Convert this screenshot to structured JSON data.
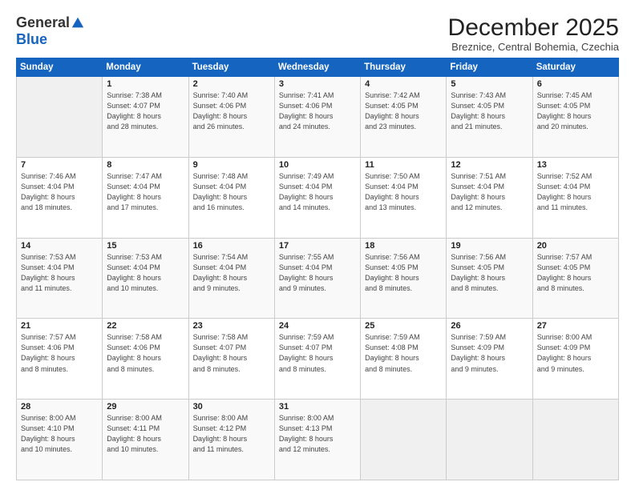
{
  "logo": {
    "general": "General",
    "blue": "Blue"
  },
  "title": "December 2025",
  "subtitle": "Breznice, Central Bohemia, Czechia",
  "weekdays": [
    "Sunday",
    "Monday",
    "Tuesday",
    "Wednesday",
    "Thursday",
    "Friday",
    "Saturday"
  ],
  "weeks": [
    [
      {
        "date": "",
        "info": ""
      },
      {
        "date": "1",
        "info": "Sunrise: 7:38 AM\nSunset: 4:07 PM\nDaylight: 8 hours\nand 28 minutes."
      },
      {
        "date": "2",
        "info": "Sunrise: 7:40 AM\nSunset: 4:06 PM\nDaylight: 8 hours\nand 26 minutes."
      },
      {
        "date": "3",
        "info": "Sunrise: 7:41 AM\nSunset: 4:06 PM\nDaylight: 8 hours\nand 24 minutes."
      },
      {
        "date": "4",
        "info": "Sunrise: 7:42 AM\nSunset: 4:05 PM\nDaylight: 8 hours\nand 23 minutes."
      },
      {
        "date": "5",
        "info": "Sunrise: 7:43 AM\nSunset: 4:05 PM\nDaylight: 8 hours\nand 21 minutes."
      },
      {
        "date": "6",
        "info": "Sunrise: 7:45 AM\nSunset: 4:05 PM\nDaylight: 8 hours\nand 20 minutes."
      }
    ],
    [
      {
        "date": "7",
        "info": "Sunrise: 7:46 AM\nSunset: 4:04 PM\nDaylight: 8 hours\nand 18 minutes."
      },
      {
        "date": "8",
        "info": "Sunrise: 7:47 AM\nSunset: 4:04 PM\nDaylight: 8 hours\nand 17 minutes."
      },
      {
        "date": "9",
        "info": "Sunrise: 7:48 AM\nSunset: 4:04 PM\nDaylight: 8 hours\nand 16 minutes."
      },
      {
        "date": "10",
        "info": "Sunrise: 7:49 AM\nSunset: 4:04 PM\nDaylight: 8 hours\nand 14 minutes."
      },
      {
        "date": "11",
        "info": "Sunrise: 7:50 AM\nSunset: 4:04 PM\nDaylight: 8 hours\nand 13 minutes."
      },
      {
        "date": "12",
        "info": "Sunrise: 7:51 AM\nSunset: 4:04 PM\nDaylight: 8 hours\nand 12 minutes."
      },
      {
        "date": "13",
        "info": "Sunrise: 7:52 AM\nSunset: 4:04 PM\nDaylight: 8 hours\nand 11 minutes."
      }
    ],
    [
      {
        "date": "14",
        "info": "Sunrise: 7:53 AM\nSunset: 4:04 PM\nDaylight: 8 hours\nand 11 minutes."
      },
      {
        "date": "15",
        "info": "Sunrise: 7:53 AM\nSunset: 4:04 PM\nDaylight: 8 hours\nand 10 minutes."
      },
      {
        "date": "16",
        "info": "Sunrise: 7:54 AM\nSunset: 4:04 PM\nDaylight: 8 hours\nand 9 minutes."
      },
      {
        "date": "17",
        "info": "Sunrise: 7:55 AM\nSunset: 4:04 PM\nDaylight: 8 hours\nand 9 minutes."
      },
      {
        "date": "18",
        "info": "Sunrise: 7:56 AM\nSunset: 4:05 PM\nDaylight: 8 hours\nand 8 minutes."
      },
      {
        "date": "19",
        "info": "Sunrise: 7:56 AM\nSunset: 4:05 PM\nDaylight: 8 hours\nand 8 minutes."
      },
      {
        "date": "20",
        "info": "Sunrise: 7:57 AM\nSunset: 4:05 PM\nDaylight: 8 hours\nand 8 minutes."
      }
    ],
    [
      {
        "date": "21",
        "info": "Sunrise: 7:57 AM\nSunset: 4:06 PM\nDaylight: 8 hours\nand 8 minutes."
      },
      {
        "date": "22",
        "info": "Sunrise: 7:58 AM\nSunset: 4:06 PM\nDaylight: 8 hours\nand 8 minutes."
      },
      {
        "date": "23",
        "info": "Sunrise: 7:58 AM\nSunset: 4:07 PM\nDaylight: 8 hours\nand 8 minutes."
      },
      {
        "date": "24",
        "info": "Sunrise: 7:59 AM\nSunset: 4:07 PM\nDaylight: 8 hours\nand 8 minutes."
      },
      {
        "date": "25",
        "info": "Sunrise: 7:59 AM\nSunset: 4:08 PM\nDaylight: 8 hours\nand 8 minutes."
      },
      {
        "date": "26",
        "info": "Sunrise: 7:59 AM\nSunset: 4:09 PM\nDaylight: 8 hours\nand 9 minutes."
      },
      {
        "date": "27",
        "info": "Sunrise: 8:00 AM\nSunset: 4:09 PM\nDaylight: 8 hours\nand 9 minutes."
      }
    ],
    [
      {
        "date": "28",
        "info": "Sunrise: 8:00 AM\nSunset: 4:10 PM\nDaylight: 8 hours\nand 10 minutes."
      },
      {
        "date": "29",
        "info": "Sunrise: 8:00 AM\nSunset: 4:11 PM\nDaylight: 8 hours\nand 10 minutes."
      },
      {
        "date": "30",
        "info": "Sunrise: 8:00 AM\nSunset: 4:12 PM\nDaylight: 8 hours\nand 11 minutes."
      },
      {
        "date": "31",
        "info": "Sunrise: 8:00 AM\nSunset: 4:13 PM\nDaylight: 8 hours\nand 12 minutes."
      },
      {
        "date": "",
        "info": ""
      },
      {
        "date": "",
        "info": ""
      },
      {
        "date": "",
        "info": ""
      }
    ]
  ]
}
